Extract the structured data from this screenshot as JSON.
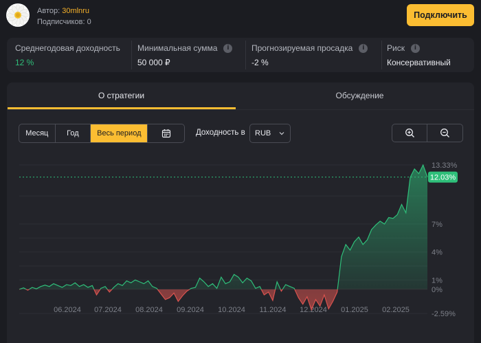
{
  "header": {
    "author_label": "Автор:",
    "author_name": "30mlnru",
    "subscribers_label": "Подписчиков:",
    "subscribers_count": "0",
    "connect_button": "Подключить"
  },
  "stats": [
    {
      "label": "Среднегодовая доходность",
      "value": "12 %",
      "info": false
    },
    {
      "label": "Минимальная сумма",
      "value": "50 000 ₽",
      "info": true
    },
    {
      "label": "Прогнозируемая просадка",
      "value": "-2 %",
      "info": true
    },
    {
      "label": "Риск",
      "value": "Консервативный",
      "info": true
    }
  ],
  "tabs": {
    "about": "О стратегии",
    "discussion": "Обсуждение"
  },
  "controls": {
    "period_month": "Месяц",
    "period_year": "Год",
    "period_all": "Весь период",
    "yield_in_label": "Доходность в",
    "currency": "RUB"
  },
  "icons": {
    "calendar": "calendar-icon",
    "chevron": "chevron-down-icon",
    "zoom_in": "zoom-in-icon",
    "zoom_out": "zoom-out-icon",
    "info": "info-icon"
  },
  "colors": {
    "accent": "#fbbd32",
    "positive": "#2fbf7a",
    "negative": "#d9534f"
  },
  "chart_data": {
    "type": "area",
    "y_ticks": [
      "13.33%",
      "7%",
      "4%",
      "1%",
      "0%",
      "-2.59%"
    ],
    "x_ticks": [
      "06.2024",
      "07.2024",
      "08.2024",
      "09.2024",
      "10.2024",
      "11.2024",
      "12.2024",
      "01.2025",
      "02.2025"
    ],
    "current_label": "12.03%",
    "current_value": 12.03,
    "ylim": [
      -2.59,
      13.33
    ],
    "grid": true,
    "series": [
      {
        "values": [
          0,
          0.15,
          -0.1,
          0.2,
          0.05,
          0.3,
          0.45,
          0.3,
          0.6,
          0.4,
          0.2,
          0.5,
          0.4,
          0.7,
          0.3,
          0.5,
          0.2,
          0.4,
          -0.6,
          0.1,
          0.3,
          -0.3,
          0.2,
          0.6,
          0.4,
          0.9,
          0.7,
          1.0,
          0.8,
          0.6,
          0.9,
          0.3,
          0.1,
          -0.5,
          -1.1,
          -0.9,
          -0.4,
          -1.3,
          -0.7,
          -0.2,
          0.1,
          0.2,
          1.2,
          0.8,
          0.3,
          0.6,
          0.1,
          1.3,
          0.6,
          0.8,
          1.6,
          1.3,
          0.7,
          1.2,
          0.9,
          0.1,
          0.3,
          -0.6,
          -0.3,
          -1.2,
          0.8,
          -0.2,
          0.5,
          0.3,
          0.1,
          -0.9,
          -1.6,
          -0.8,
          -2.2,
          -1.1,
          -1.8,
          -0.6,
          -2.1,
          -1.3,
          -0.3,
          3.5,
          4.8,
          4.2,
          5.1,
          5.6,
          4.8,
          5.3,
          6.4,
          6.9,
          7.3,
          7.0,
          7.7,
          7.6,
          8.0,
          9.1,
          8.2,
          12.0,
          12.9,
          12.4,
          13.33,
          12.03
        ]
      }
    ]
  }
}
